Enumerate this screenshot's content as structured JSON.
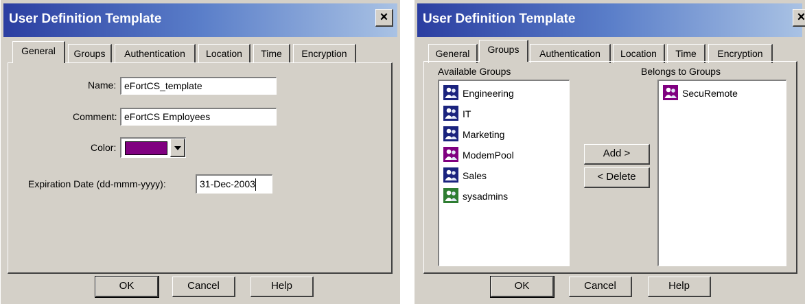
{
  "general_dialog": {
    "title": "User Definition Template",
    "close_glyph": "×",
    "tabs": [
      "General",
      "Groups",
      "Authentication",
      "Location",
      "Time",
      "Encryption"
    ],
    "active_tab": "General",
    "fields": {
      "name_label": "Name:",
      "name_value": "eFortCS_template",
      "comment_label": "Comment:",
      "comment_value": "eFortCS Employees",
      "color_label": "Color:",
      "color_value": "#800080",
      "expiration_label": "Expiration Date (dd-mmm-yyyy):",
      "expiration_value": "31-Dec-2003"
    },
    "buttons": {
      "ok": "OK",
      "cancel": "Cancel",
      "help": "Help"
    }
  },
  "groups_dialog": {
    "title": "User Definition Template",
    "close_glyph": "×",
    "tabs": [
      "General",
      "Groups",
      "Authentication",
      "Location",
      "Time",
      "Encryption"
    ],
    "active_tab": "Groups",
    "available_label": "Available Groups",
    "belongs_label": "Belongs to Groups",
    "available_groups": [
      {
        "name": "Engineering",
        "icon": "group-icon",
        "color": "#1a237e"
      },
      {
        "name": "IT",
        "icon": "group-icon",
        "color": "#1a237e"
      },
      {
        "name": "Marketing",
        "icon": "group-icon",
        "color": "#1a237e"
      },
      {
        "name": "ModemPool",
        "icon": "group-icon",
        "color": "#800080"
      },
      {
        "name": "Sales",
        "icon": "group-icon",
        "color": "#1a237e"
      },
      {
        "name": "sysadmins",
        "icon": "group-icon",
        "color": "#2e7d32"
      }
    ],
    "member_groups": [
      {
        "name": "SecuRemote",
        "icon": "group-icon",
        "color": "#800080"
      }
    ],
    "add_button": "Add >",
    "delete_button": "< Delete",
    "buttons": {
      "ok": "OK",
      "cancel": "Cancel",
      "help": "Help"
    }
  }
}
